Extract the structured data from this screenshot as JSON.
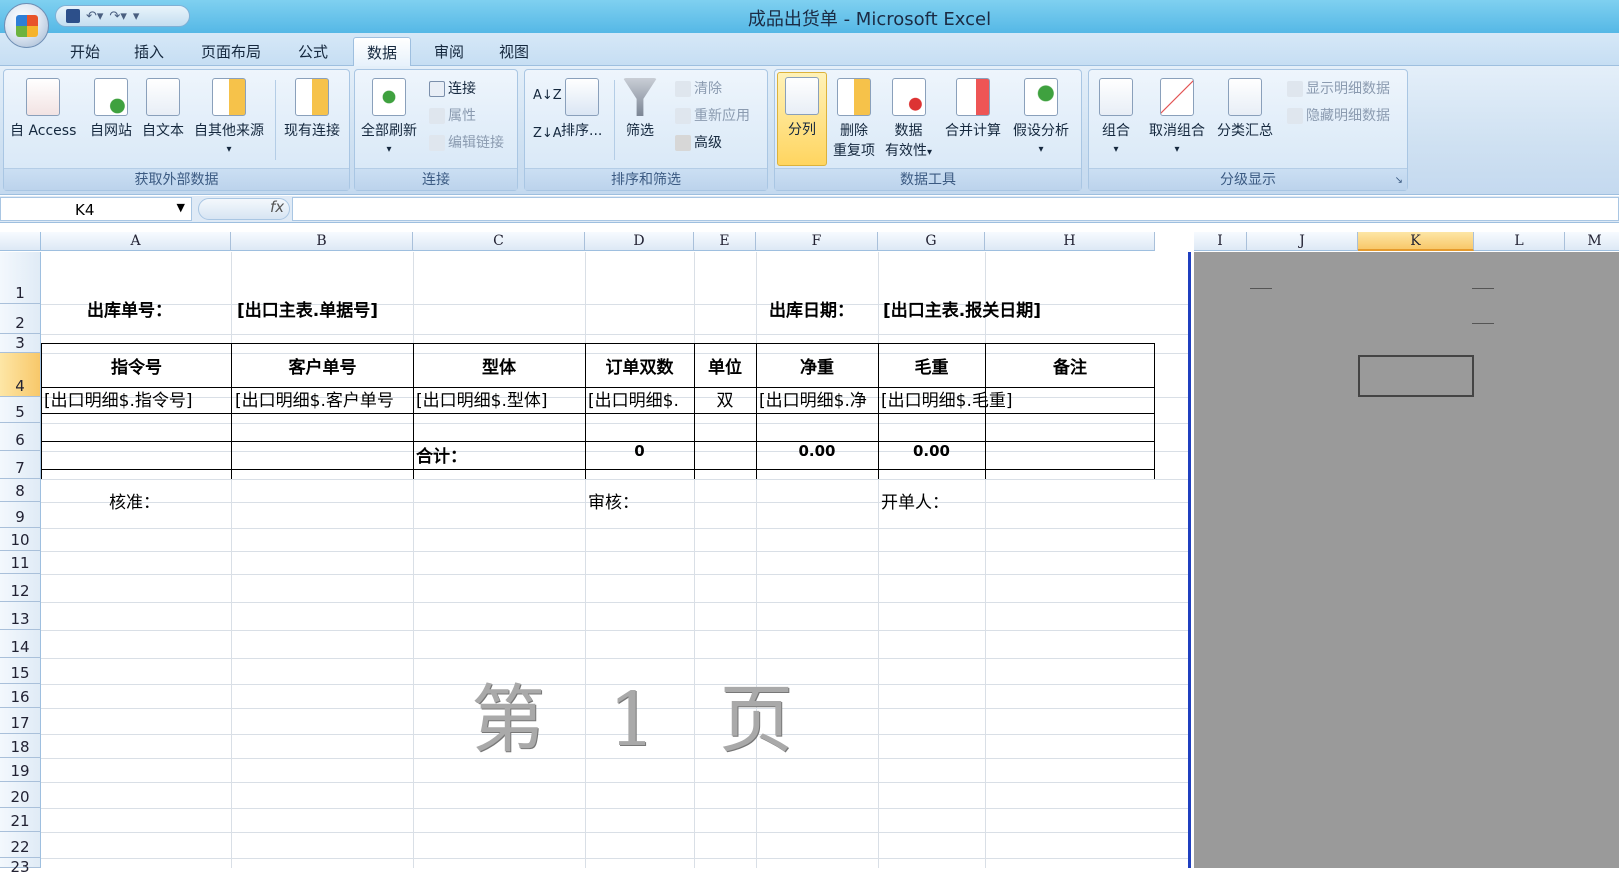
{
  "window": {
    "title": "成品出货单 - Microsoft Excel"
  },
  "qat": {
    "save_icon": "save-icon",
    "undo_icon": "undo-icon",
    "redo_icon": "redo-icon",
    "customize": "▾"
  },
  "tabs": [
    {
      "label": "开始"
    },
    {
      "label": "插入"
    },
    {
      "label": "页面布局"
    },
    {
      "label": "公式"
    },
    {
      "label": "数据",
      "active": true
    },
    {
      "label": "审阅"
    },
    {
      "label": "视图"
    }
  ],
  "ribbon": {
    "get_external": {
      "label": "获取外部数据",
      "access": "自 Access",
      "web": "自网站",
      "text": "自文本",
      "other": "自其他来源",
      "existing": "现有连接"
    },
    "connections": {
      "label": "连接",
      "refresh_all": "全部刷新",
      "connections": "连接",
      "properties": "属性",
      "edit_links": "编辑链接"
    },
    "sort_filter": {
      "label": "排序和筛选",
      "sort_az": "A↓Z",
      "sort_za": "Z↓A",
      "sort": "排序...",
      "filter": "筛选",
      "clear": "清除",
      "reapply": "重新应用",
      "advanced": "高级"
    },
    "data_tools": {
      "label": "数据工具",
      "text_to_columns": "分列",
      "remove_dup_1": "删除",
      "remove_dup_2": "重复项",
      "validation_1": "数据",
      "validation_2": "有效性",
      "consolidate": "合并计算",
      "whatif": "假设分析"
    },
    "outline": {
      "label": "分级显示",
      "group": "组合",
      "ungroup": "取消组合",
      "subtotal": "分类汇总",
      "show_detail": "显示明细数据",
      "hide_detail": "隐藏明细数据"
    }
  },
  "formula_bar": {
    "name_box": "K4",
    "fx": "fx",
    "formula": ""
  },
  "columns": [
    "A",
    "B",
    "C",
    "D",
    "E",
    "F",
    "G",
    "H",
    "I",
    "J",
    "K",
    "L",
    "M"
  ],
  "selected_column": "K",
  "rows": [
    "1",
    "2",
    "3",
    "4",
    "5",
    "6",
    "7",
    "8",
    "9",
    "10",
    "11",
    "12",
    "13",
    "14",
    "15",
    "16",
    "17",
    "18",
    "19",
    "20",
    "21",
    "22",
    "23"
  ],
  "selected_row": "4",
  "sheet": {
    "r2": {
      "out_no_label": "出库单号：",
      "out_no_value": "[出口主表.单据号]",
      "date_label": "出库日期：",
      "date_value": "[出口主表.报关日期]"
    },
    "header": {
      "a": "指令号",
      "b": "客户单号",
      "c": "型体",
      "d": "订单双数",
      "e": "单位",
      "f": "净重",
      "g": "毛重",
      "h": "备注"
    },
    "r5": {
      "a": "[出口明细$.指令号]",
      "b": "[出口明细$.客户单号",
      "c": "[出口明细$.型体]",
      "d": "[出口明细$.",
      "e": "双",
      "f": "[出口明细$.净",
      "g": "[出口明细$.毛重]"
    },
    "r7": {
      "c": "合计：",
      "d": "0",
      "f": "0.00",
      "g": "0.00"
    },
    "r9": {
      "a": "核准：",
      "d": "审核：",
      "g": "开单人："
    },
    "watermark": "第 1 页"
  }
}
